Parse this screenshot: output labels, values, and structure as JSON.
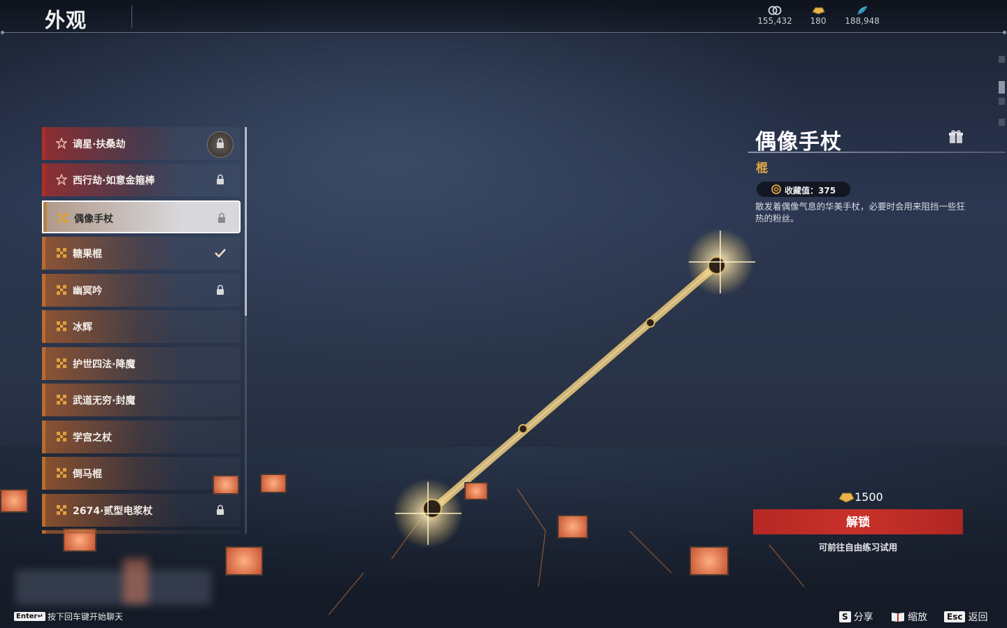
{
  "header": {
    "title": "外观"
  },
  "currencies": [
    {
      "icon": "coin-icon",
      "value": "155,432"
    },
    {
      "icon": "gold-ingot-icon",
      "value": "180"
    },
    {
      "icon": "feather-icon",
      "value": "188,948"
    }
  ],
  "list": {
    "items": [
      {
        "label": "谪星·扶桑劫",
        "rarity": "red",
        "state": "locked-special"
      },
      {
        "label": "西行劫·如意金箍棒",
        "rarity": "red",
        "state": "locked"
      },
      {
        "label": "偶像手杖",
        "rarity": "gold",
        "state": "locked",
        "selected": true
      },
      {
        "label": "糖果棍",
        "rarity": "gold",
        "state": "owned"
      },
      {
        "label": "幽冥吟",
        "rarity": "gold",
        "state": "locked"
      },
      {
        "label": "冰辉",
        "rarity": "gold",
        "state": "none"
      },
      {
        "label": "护世四法·降魔",
        "rarity": "gold",
        "state": "none"
      },
      {
        "label": "武道无穷·封魔",
        "rarity": "gold",
        "state": "none"
      },
      {
        "label": "学宫之杖",
        "rarity": "gold",
        "state": "none"
      },
      {
        "label": "倒马棍",
        "rarity": "gold",
        "state": "none"
      },
      {
        "label": "2674·贰型电浆杖",
        "rarity": "gold",
        "state": "locked"
      }
    ]
  },
  "detail": {
    "name": "偶像手杖",
    "type": "棍",
    "collection": "收藏值：375",
    "description": "散发着偶像气息的华美手杖，必要时会用来阻挡一些狂热的粉丝。",
    "price": "1500",
    "unlock_label": "解锁",
    "trial_note": "可前往自由练习试用"
  },
  "footer": {
    "chat_key": "Enter↵",
    "chat_hint": "按下回车键开始聊天",
    "actions": [
      {
        "key": "S",
        "label": "分享"
      },
      {
        "key": "📖",
        "label": "缩放"
      },
      {
        "key": "Esc",
        "label": "返回"
      }
    ]
  },
  "colors": {
    "accent_red": "#c23a32",
    "accent_gold": "#e0a03c",
    "button_red": "#c8312a"
  }
}
